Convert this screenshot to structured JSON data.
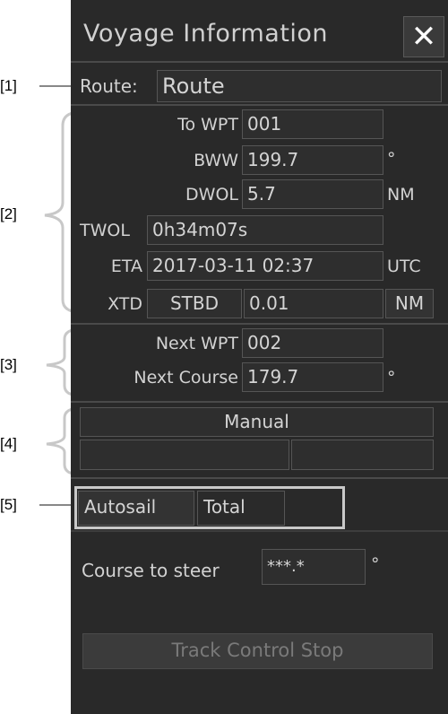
{
  "window": {
    "title": "Voyage Information",
    "close_glyph": "✕"
  },
  "route": {
    "label": "Route:",
    "value": "Route"
  },
  "waypoint": {
    "to_wpt_label": "To WPT",
    "to_wpt_value": "001",
    "bww_label": "BWW",
    "bww_value": "199.7",
    "bww_unit": "°",
    "dwol_label": "DWOL",
    "dwol_value": "5.7",
    "dwol_unit": "NM",
    "twol_label": "TWOL",
    "twol_value": "0h34m07s",
    "eta_label": "ETA",
    "eta_value": "2017-03-11 02:37",
    "eta_unit": "UTC",
    "xtd_label": "XTD",
    "xtd_side": "STBD",
    "xtd_value": "0.01",
    "xtd_unit": "NM"
  },
  "next": {
    "next_wpt_label": "Next WPT",
    "next_wpt_value": "002",
    "next_course_label": "Next Course",
    "next_course_value": "179.7",
    "next_course_unit": "°"
  },
  "mode": {
    "value": "Manual",
    "left_value": "",
    "right_value": ""
  },
  "tabs": [
    {
      "label": "Autosail",
      "selected": true
    },
    {
      "label": "Total",
      "selected": false
    }
  ],
  "autosail": {
    "course_to_steer_label": "Course to steer",
    "course_to_steer_value": "***.*",
    "course_to_steer_unit": "°",
    "track_control_button": "Track Control Stop"
  },
  "annotations": [
    "[1]",
    "[2]",
    "[3]",
    "[4]",
    "[5]"
  ],
  "colors": {
    "panel_bg": "#292929",
    "text": "#d2d2d2",
    "field_border": "#555555",
    "callout": "#c8c8c8"
  }
}
